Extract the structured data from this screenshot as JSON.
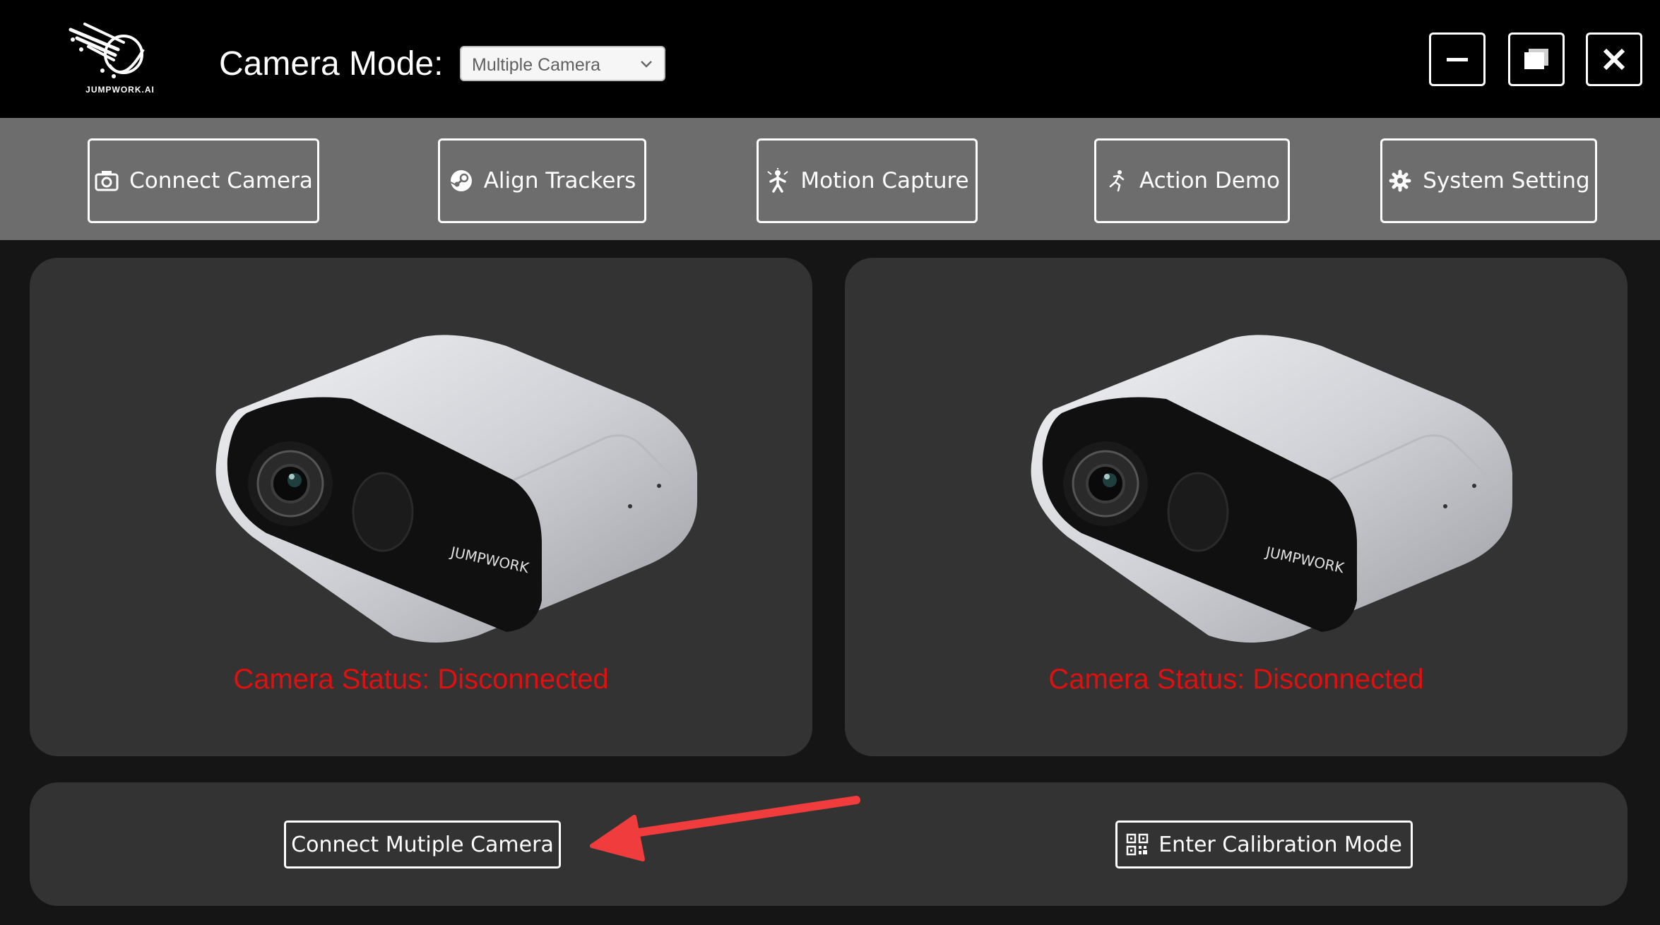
{
  "app": {
    "logo_text": "JUMPWORK.AI",
    "logo_icon": "jumpwork-logo-icon"
  },
  "header": {
    "mode_label": "Camera Mode:",
    "mode_select": {
      "value": "Multiple Camera"
    },
    "window_controls": [
      "minimize-icon",
      "restore-icon",
      "close-icon"
    ]
  },
  "toolbar": {
    "items": [
      {
        "label": "Connect Camera",
        "icon": "camera-icon"
      },
      {
        "label": "Align Trackers",
        "icon": "steam-icon"
      },
      {
        "label": "Motion Capture",
        "icon": "motion-figure-icon"
      },
      {
        "label": "Action Demo",
        "icon": "running-figure-icon"
      },
      {
        "label": "System Setting",
        "icon": "gear-icon"
      }
    ]
  },
  "cameras": [
    {
      "brand": "JUMPWORK",
      "status": "Camera Status: Disconnected"
    },
    {
      "brand": "JUMPWORK",
      "status": "Camera Status: Disconnected"
    }
  ],
  "footer": {
    "connect_label": "Connect Mutiple Camera",
    "calibration_label": "Enter Calibration Mode",
    "calibration_icon": "qr-code-icon"
  },
  "colors": {
    "titlebar": "#000000",
    "toolbar": "#6d6d6d",
    "panel": "#333333",
    "status_text": "#e01010",
    "annotation_arrow": "#f03c3c"
  }
}
